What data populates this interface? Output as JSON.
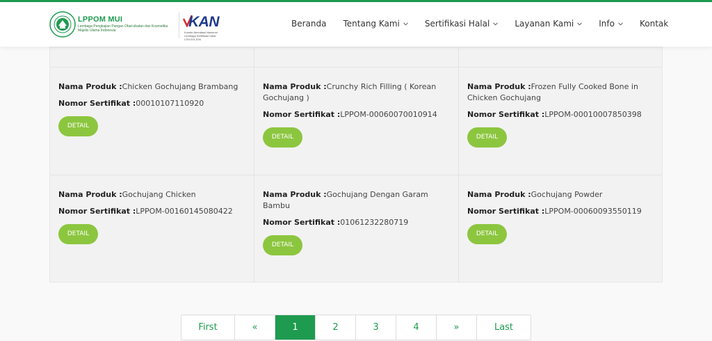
{
  "header": {
    "logo_title": "LPPOM MUI",
    "logo_subtitle_1": "Lembaga Pengkajian Pangan Obat-obatan dan Kosmetika",
    "logo_subtitle_2": "Majelis Ulama Indonesia",
    "kan_logo": "KAN",
    "kan_sub_1": "Komite Akreditasi Nasional",
    "kan_sub_2": "Lembaga Sertifikasi Halal",
    "kan_sub_3": "LSH-001-IDN",
    "nav": [
      {
        "label": "Beranda",
        "dropdown": false
      },
      {
        "label": "Tentang Kami",
        "dropdown": true
      },
      {
        "label": "Sertifikasi Halal",
        "dropdown": true
      },
      {
        "label": "Layanan Kami",
        "dropdown": true
      },
      {
        "label": "Info",
        "dropdown": true
      },
      {
        "label": "Kontak",
        "dropdown": false
      }
    ]
  },
  "products": [
    {
      "name_label": "Nama Produk :",
      "name": "Chicken Gochujang Brambang",
      "cert_label": "Nomor Sertifikat :",
      "cert": "00010107110920",
      "button": "DETAIL"
    },
    {
      "name_label": "Nama Produk :",
      "name": "Crunchy Rich Filling ( Korean Gochujang )",
      "cert_label": "Nomor Sertifikat :",
      "cert": "LPPOM-00060070010914",
      "button": "DETAIL"
    },
    {
      "name_label": "Nama Produk :",
      "name": "Frozen Fully Cooked Bone in Chicken Gochujang",
      "cert_label": "Nomor Sertifikat :",
      "cert": "LPPOM-00010007850398",
      "button": "DETAIL"
    },
    {
      "name_label": "Nama Produk :",
      "name": "Gochujang Chicken",
      "cert_label": "Nomor Sertifikat :",
      "cert": "LPPOM-00160145080422",
      "button": "DETAIL"
    },
    {
      "name_label": "Nama Produk :",
      "name": "Gochujang Dengan Garam Bambu",
      "cert_label": "Nomor Sertifikat :",
      "cert": "01061232280719",
      "button": "DETAIL"
    },
    {
      "name_label": "Nama Produk :",
      "name": "Gochujang Powder",
      "cert_label": "Nomor Sertifikat :",
      "cert": "LPPOM-00060093550119",
      "button": "DETAIL"
    }
  ],
  "pagination": {
    "first": "First",
    "prev": "«",
    "pages": [
      "1",
      "2",
      "3",
      "4"
    ],
    "current": "1",
    "next": "»",
    "last": "Last"
  },
  "colors": {
    "brand_green": "#1e9b4f",
    "button_green": "#8cc63f",
    "kan_blue": "#1f3a8a",
    "kan_red": "#d32f2f"
  }
}
